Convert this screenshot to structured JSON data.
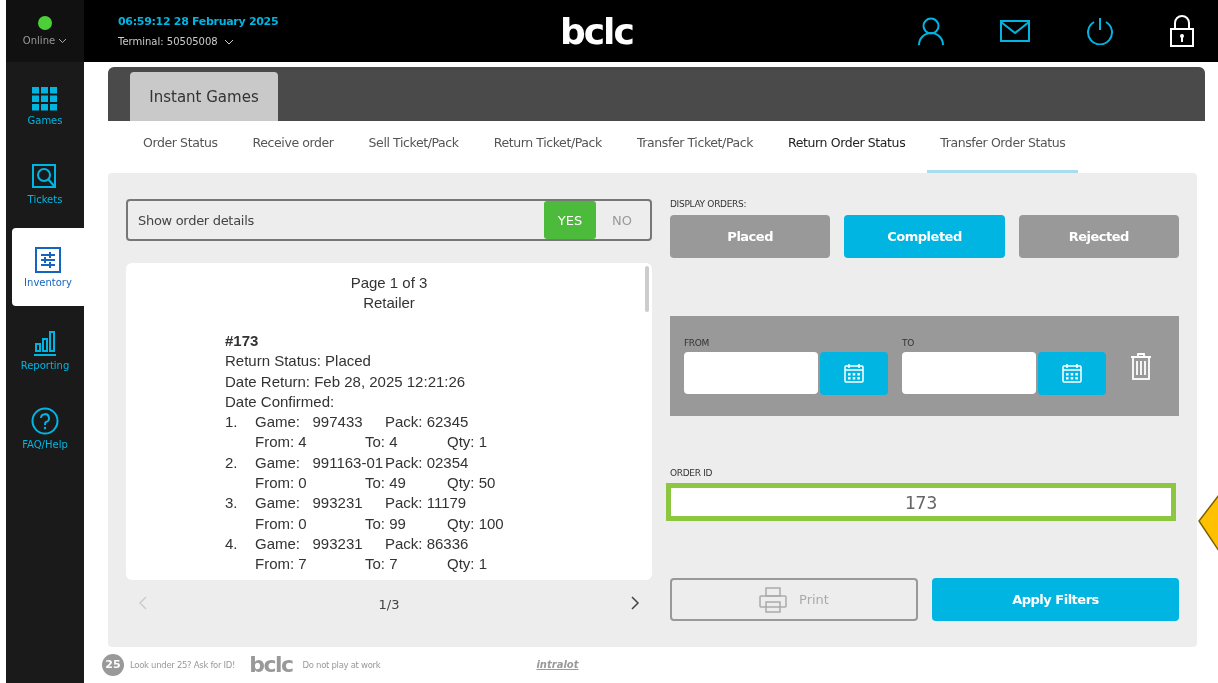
{
  "status": {
    "label": "Online",
    "online": true
  },
  "header": {
    "datetime": "06:59:12  28 February 2025",
    "terminal": "Terminal: 50505008",
    "logo": "bclc"
  },
  "sidebar": {
    "items": [
      {
        "label": "Games",
        "kind": "grid",
        "selected": false
      },
      {
        "label": "Tickets",
        "kind": "search",
        "selected": false
      },
      {
        "label": "Inventory",
        "kind": "sliders",
        "selected": true
      },
      {
        "label": "Reporting",
        "kind": "chart",
        "selected": false
      },
      {
        "label": "FAQ/Help",
        "kind": "help",
        "selected": false
      }
    ]
  },
  "section_tab": "Instant Games",
  "tabs": [
    {
      "label": "Order Status",
      "selected": false,
      "underline": false
    },
    {
      "label": "Receive order",
      "selected": false,
      "underline": false
    },
    {
      "label": "Sell Ticket/Pack",
      "selected": false,
      "underline": false
    },
    {
      "label": "Return Ticket/Pack",
      "selected": false,
      "underline": false
    },
    {
      "label": "Transfer Ticket/Pack",
      "selected": false,
      "underline": false
    },
    {
      "label": "Return Order Status",
      "selected": true,
      "underline": false
    },
    {
      "label": "Transfer Order Status",
      "selected": false,
      "underline": true
    }
  ],
  "order_details_toggle": {
    "label": "Show order details",
    "options": [
      {
        "label": "YES",
        "selected": true
      },
      {
        "label": "NO",
        "selected": false
      }
    ]
  },
  "document": {
    "header": [
      "Page 1 of 3",
      "Retailer"
    ],
    "order_no": "#173",
    "lines": [
      "Return Status: Placed",
      "Date Return: Feb 28, 2025  12:21:26",
      "Date Confirmed:"
    ],
    "items": [
      {
        "num": "1.",
        "game": "Game:   997433",
        "pack": "Pack: 62345",
        "from": "From: 4",
        "to": "To: 4",
        "qty": "Qty: 1"
      },
      {
        "num": "2.",
        "game": "Game:   991163-01",
        "pack": "Pack: 02354",
        "from": "From: 0",
        "to": "To: 49",
        "qty": "Qty: 50"
      },
      {
        "num": "3.",
        "game": "Game:   993231",
        "pack": "Pack: 11179",
        "from": "From: 0",
        "to": "To: 99",
        "qty": "Qty: 100"
      },
      {
        "num": "4.",
        "game": "Game:   993231",
        "pack": "Pack: 86336",
        "from": "From: 7",
        "to": "To: 7",
        "qty": "Qty: 1"
      }
    ]
  },
  "pagination": {
    "label": "1/3",
    "prev_disabled": true,
    "next_disabled": false
  },
  "display_orders": {
    "label": "DISPLAY ORDERS:",
    "options": [
      {
        "label": "Placed",
        "selected": false
      },
      {
        "label": "Completed",
        "selected": true
      },
      {
        "label": "Rejected",
        "selected": false
      }
    ]
  },
  "date_filter": {
    "from_label": "FROM",
    "to_label": "TO"
  },
  "order_id": {
    "label": "ORDER ID",
    "value": "173"
  },
  "buttons": {
    "print": "Print",
    "apply": "Apply Filters"
  },
  "footer": {
    "age_badge": "25",
    "age_text": "Look under 25? Ask for ID!",
    "logo": "bclc",
    "work_text": "Do not play at work",
    "partner": "intralot"
  }
}
